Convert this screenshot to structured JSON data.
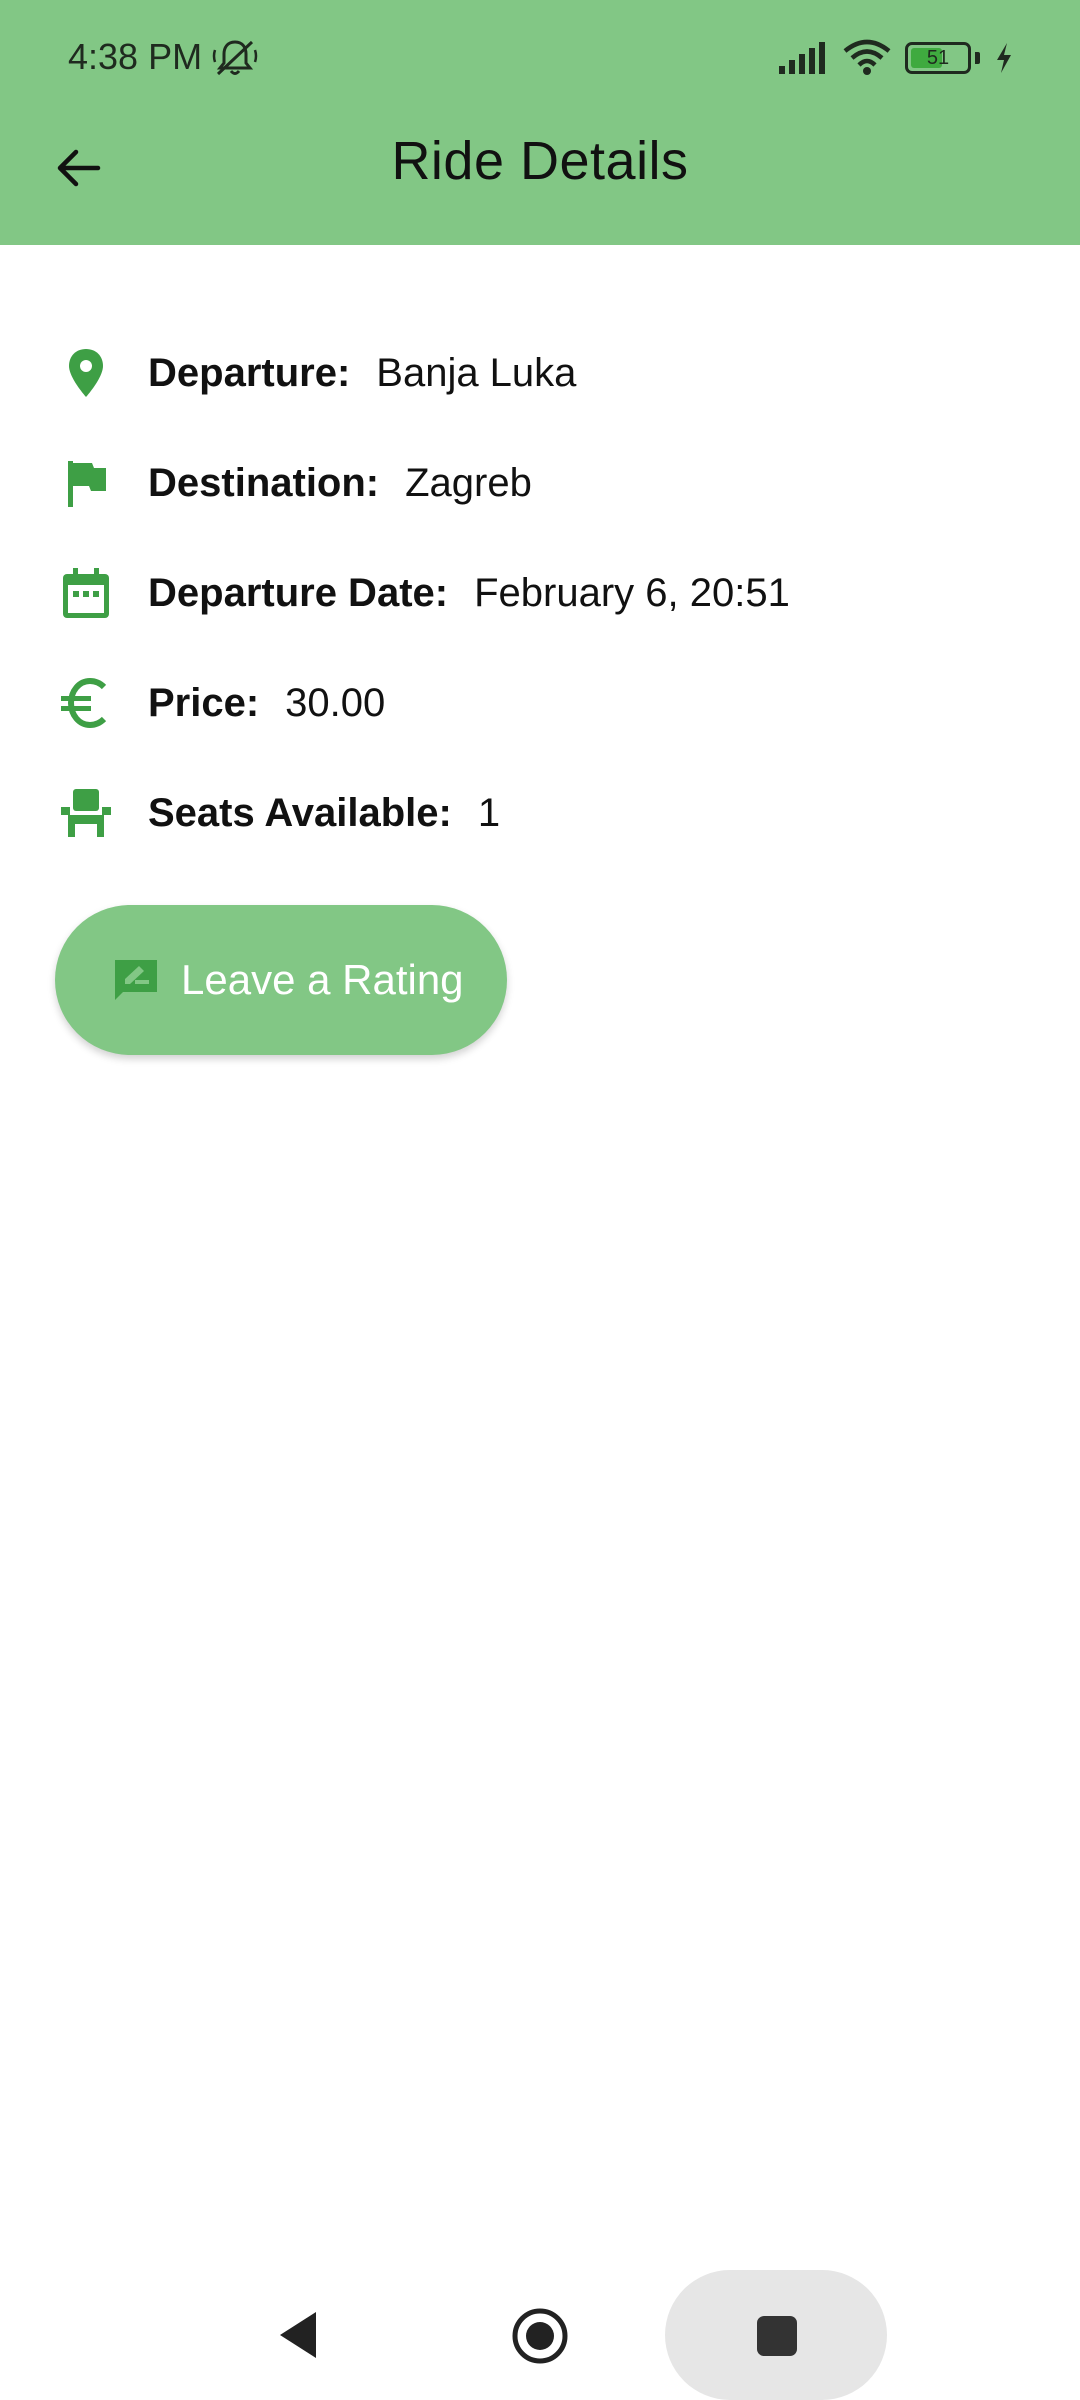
{
  "status_bar": {
    "time": "4:38 PM",
    "battery": "51",
    "icons": [
      "mute-bell-icon",
      "signal-icon",
      "wifi-icon",
      "battery-icon",
      "charging-bolt-icon"
    ]
  },
  "header": {
    "title": "Ride Details",
    "back_icon": "arrow-left-icon"
  },
  "details": [
    {
      "icon": "location-pin-icon",
      "label": "Departure:",
      "value": "Banja Luka"
    },
    {
      "icon": "flag-icon",
      "label": "Destination:",
      "value": "Zagreb"
    },
    {
      "icon": "calendar-icon",
      "label": "Departure Date:",
      "value": "February 6, 20:51"
    },
    {
      "icon": "euro-icon",
      "label": "Price:",
      "value": "30.00"
    },
    {
      "icon": "seat-icon",
      "label": "Seats Available:",
      "value": "1"
    }
  ],
  "rating_button": {
    "label": "Leave a Rating",
    "icon": "rate-review-icon"
  },
  "nav_bar": {
    "icons": [
      "nav-back-icon",
      "nav-home-icon",
      "nav-recents-icon"
    ]
  },
  "colors": {
    "accent": "#82c785",
    "icon_green": "#3e9f45",
    "text": "#111111",
    "background": "#ffffff"
  }
}
